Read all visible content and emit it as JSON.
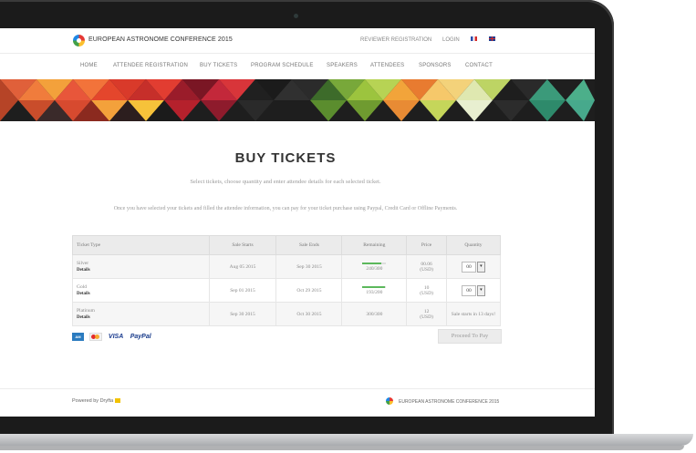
{
  "site": {
    "name": "EUROPEAN ASTRONOME CONFERENCE 2015",
    "top_links": [
      "REVIEWER REGISTRATION",
      "LOGIN"
    ],
    "languages": [
      "fr",
      "en"
    ]
  },
  "nav": {
    "items": [
      "HOME",
      "ATTENDEE REGISTRATION",
      "BUY TICKETS",
      "PROGRAM SCHEDULE",
      "SPEAKERS",
      "ATTENDEES",
      "SPONSORS",
      "CONTACT"
    ]
  },
  "page": {
    "title": "BUY TICKETS",
    "subtitle": "Select tickets, choose quantity and enter attendee details for each selected ticket.",
    "info": "Once you have selected your tickets and filled the attendee information, you can pay for your ticket purchase using Paypal, Credit Card or Offline Payments."
  },
  "table": {
    "headers": [
      "Ticket Type",
      "Sale Starts",
      "Sale Ends",
      "Remaining",
      "Price",
      "Quantity"
    ],
    "rows": [
      {
        "name": "Silver",
        "details": "Details",
        "starts": "Aug 05 2015",
        "ends": "Sep 30 2015",
        "remaining": "240/300",
        "remaining_fraction": 0.8,
        "price": "00.06",
        "currency": "(USD)",
        "qty": "00",
        "status": ""
      },
      {
        "name": "Gold",
        "details": "Details",
        "starts": "Sep 01 2015",
        "ends": "Oct 29 2015",
        "remaining": "193/200",
        "remaining_fraction": 0.965,
        "price": "10",
        "currency": "(USD)",
        "qty": "00",
        "status": ""
      },
      {
        "name": "Platinum",
        "details": "Details",
        "starts": "Sep 30 2015",
        "ends": "Oct 30 2015",
        "remaining": "300/300",
        "remaining_fraction": 1.0,
        "price": "12",
        "currency": "(USD)",
        "qty": "",
        "status": "Sale starts in 13 days!"
      }
    ]
  },
  "payments": {
    "methods": [
      "amex-icon",
      "mastercard-icon",
      "VISA",
      "PayPal"
    ],
    "button": "Proceed To Pay"
  },
  "footer": {
    "powered": "Powered by Dryfta",
    "name": "EUROPEAN ASTRONOME CONFERENCE 2015"
  },
  "colors": {
    "accent_green": "#5cb85c",
    "bezel": "#1b1b1b"
  }
}
